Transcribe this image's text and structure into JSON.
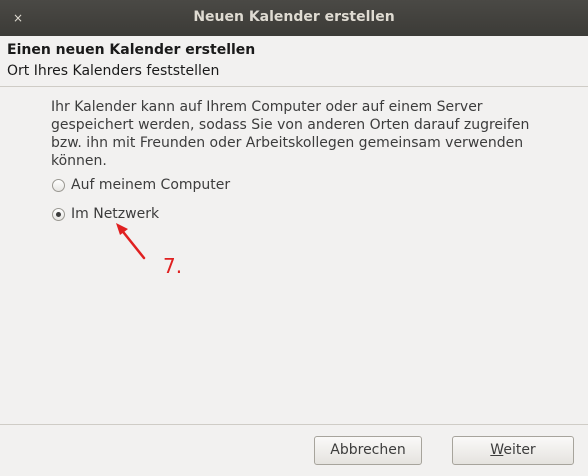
{
  "window": {
    "title": "Neuen Kalender erstellen",
    "close_glyph": "×"
  },
  "header": {
    "title": "Einen neuen Kalender erstellen",
    "subtitle": "Ort Ihres Kalenders feststellen"
  },
  "main": {
    "description": "Ihr Kalender kann auf Ihrem Computer oder auf einem Server gespeichert werden, sodass Sie von anderen Orten darauf zugreifen bzw. ihn mit Freunden oder Arbeitskollegen gemeinsam verwenden können.",
    "options": [
      {
        "label": "Auf meinem Computer",
        "checked": false
      },
      {
        "label": "Im Netzwerk",
        "checked": true
      }
    ]
  },
  "annotation": {
    "label": "7.",
    "color": "#e02020"
  },
  "buttons": {
    "cancel": "Abbrechen",
    "next_mnemonic": "W",
    "next_rest": "eiter"
  },
  "icons": {
    "close": "close-icon",
    "radio": "radio-button-icon"
  }
}
